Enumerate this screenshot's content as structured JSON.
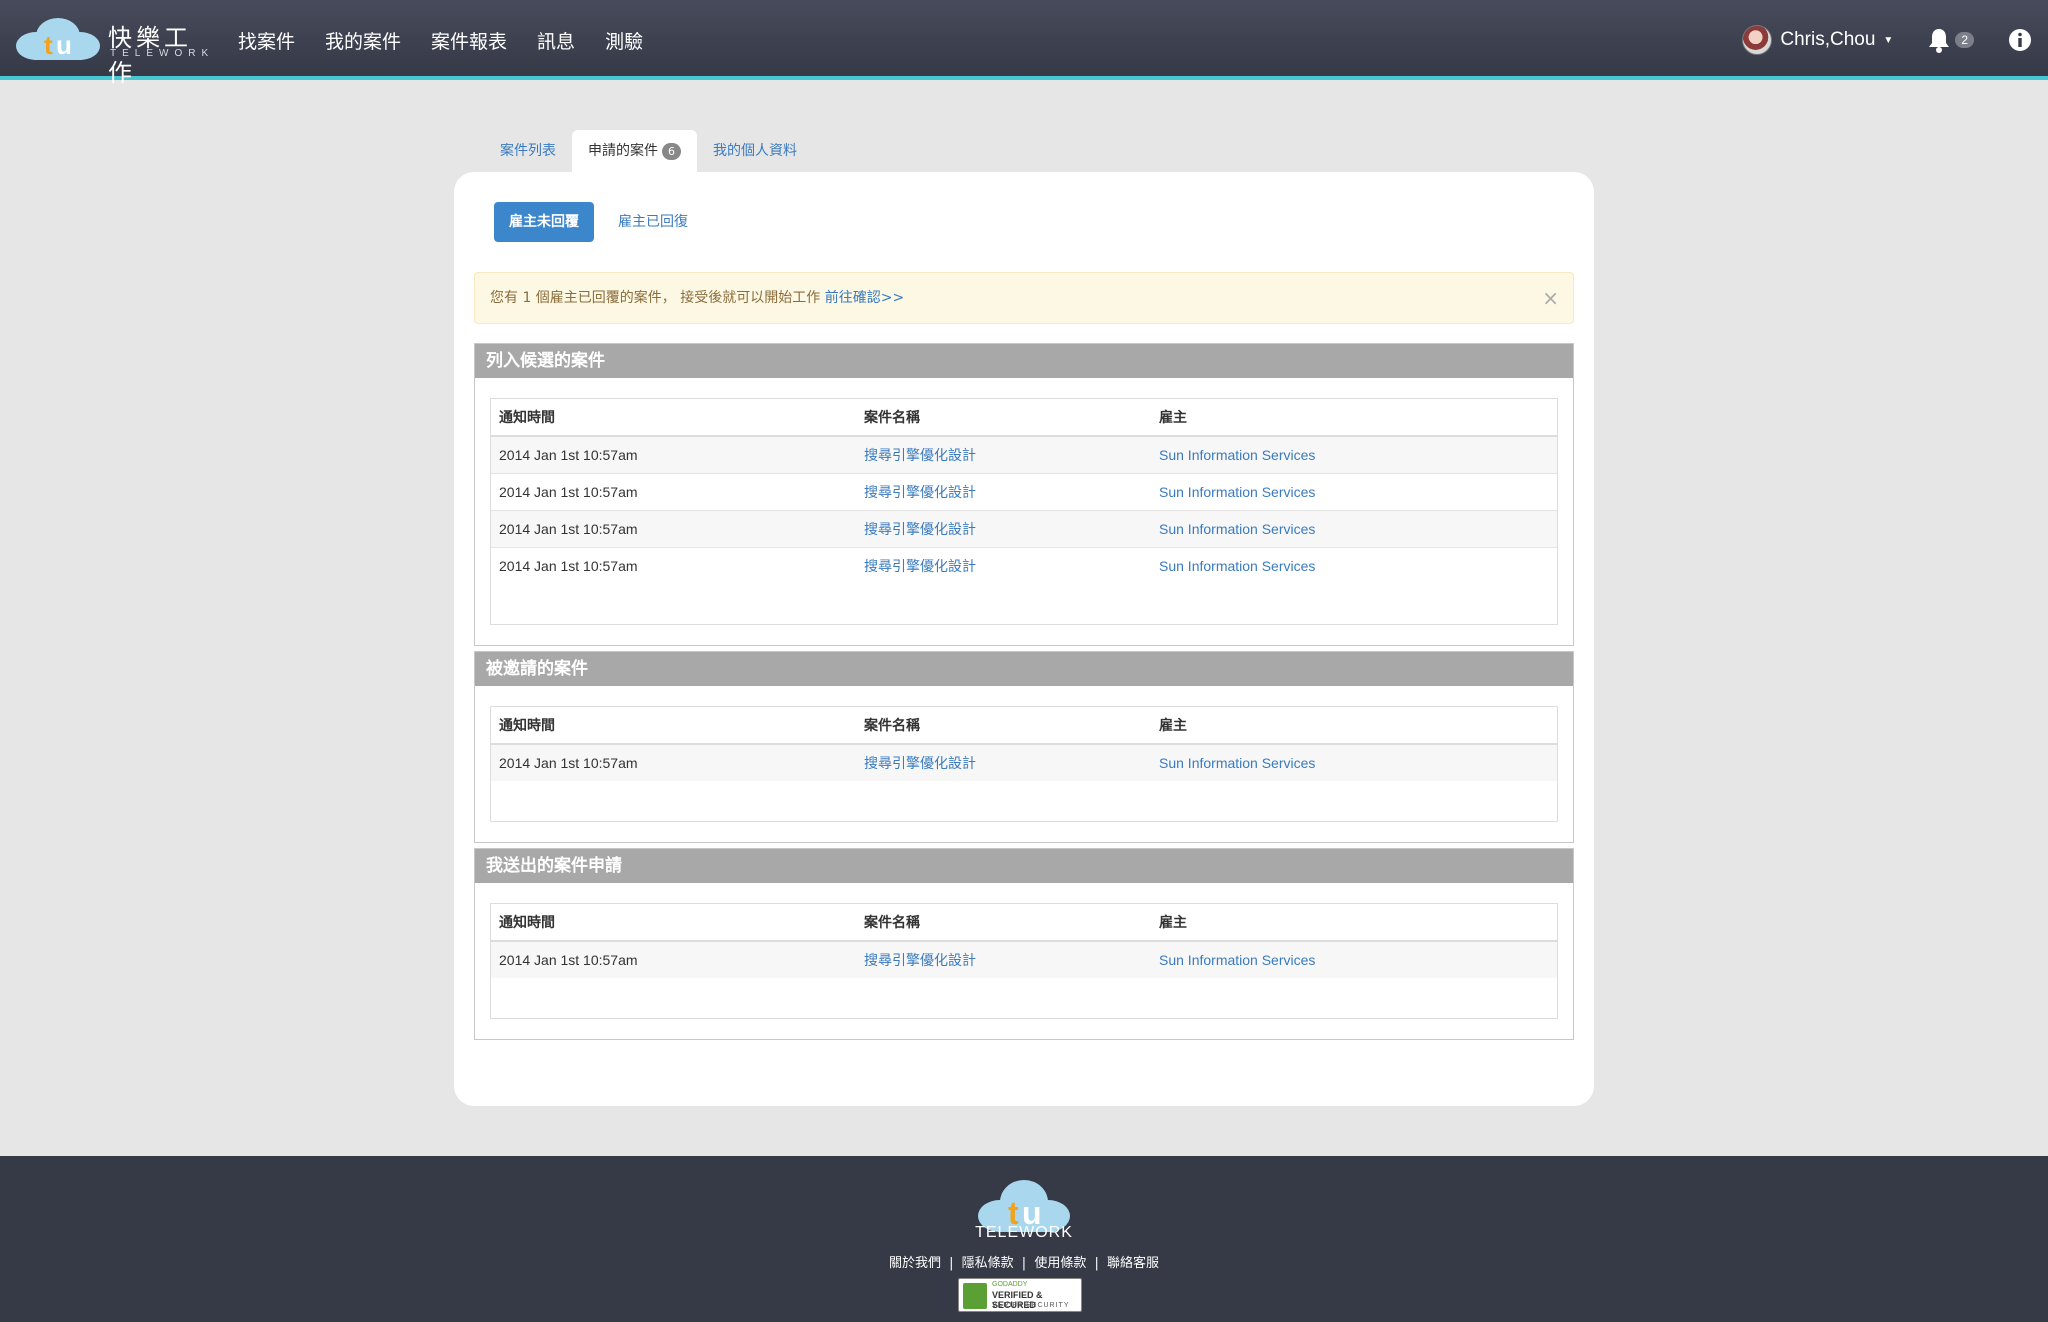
{
  "brand": {
    "name_zh": "快樂工作",
    "name_en": "TELEWORK",
    "logo_letters": "tu"
  },
  "nav": {
    "items": [
      "找案件",
      "我的案件",
      "案件報表",
      "訊息",
      "測驗"
    ]
  },
  "user": {
    "name": "Chris,Chou",
    "notifications": "2"
  },
  "tabs": [
    {
      "label": "案件列表"
    },
    {
      "label": "申請的案件",
      "badge": "6"
    },
    {
      "label": "我的個人資料"
    }
  ],
  "subtabs": {
    "active": "雇主未回覆",
    "other": "雇主已回復"
  },
  "alert": {
    "text": "您有 1 個雇主已回覆的案件， 接受後就可以開始工作",
    "link": "前往確認>>",
    "close": "×"
  },
  "columns": {
    "time": "通知時間",
    "name": "案件名稱",
    "employer": "雇主"
  },
  "sections": [
    {
      "title": "列入候選的案件",
      "rows": [
        {
          "time": "2014 Jan 1st 10:57am",
          "name": "搜尋引擎優化設計",
          "employer": "Sun Information Services"
        },
        {
          "time": "2014 Jan 1st 10:57am",
          "name": "搜尋引擎優化設計",
          "employer": "Sun Information Services"
        },
        {
          "time": "2014 Jan 1st 10:57am",
          "name": "搜尋引擎優化設計",
          "employer": "Sun Information Services"
        },
        {
          "time": "2014 Jan 1st 10:57am",
          "name": "搜尋引擎優化設計",
          "employer": "Sun Information Services"
        }
      ]
    },
    {
      "title": "被邀請的案件",
      "rows": [
        {
          "time": "2014 Jan 1st 10:57am",
          "name": "搜尋引擎優化設計",
          "employer": "Sun Information Services"
        }
      ]
    },
    {
      "title": "我送出的案件申請",
      "rows": [
        {
          "time": "2014 Jan 1st 10:57am",
          "name": "搜尋引擎優化設計",
          "employer": "Sun Information Services"
        }
      ]
    }
  ],
  "footer": {
    "logo_text": "TELEWORK",
    "links": [
      "關於我們",
      "隱私條款",
      "使用條款",
      "聯絡客服"
    ],
    "separator": "|",
    "seal": {
      "line1": "GODADDY",
      "line2": "VERIFIED & SECURED",
      "line3": "VERIFY SECURITY"
    }
  }
}
